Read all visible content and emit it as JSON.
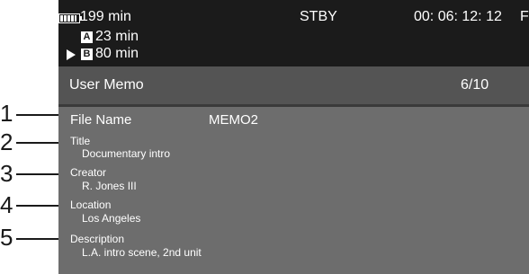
{
  "status": {
    "battery_icon": "battery-icon",
    "battery_time": "199 min",
    "card_a": {
      "badge": "A",
      "time": "23 min"
    },
    "card_b": {
      "badge": "B",
      "time": "80 min"
    },
    "mode": "STBY",
    "timecode": "00: 06: 12: 12",
    "timecode_suffix": "F"
  },
  "header": {
    "title": "User Memo",
    "page": "6/10"
  },
  "callouts": [
    "1",
    "2",
    "3",
    "4",
    "5"
  ],
  "fields": [
    {
      "label": "File Name",
      "value": "MEMO2"
    },
    {
      "label": "Title",
      "value": "Documentary intro"
    },
    {
      "label": "Creator",
      "value": "R. Jones III"
    },
    {
      "label": "Location",
      "value": "Los Angeles"
    },
    {
      "label": "Description",
      "value": "L.A. intro scene, 2nd unit"
    }
  ],
  "colors": {
    "status_bg": "#1b1b1b",
    "screen_bg": "#6d6d6d",
    "title_bg": "#545454",
    "text": "#ffffff"
  }
}
